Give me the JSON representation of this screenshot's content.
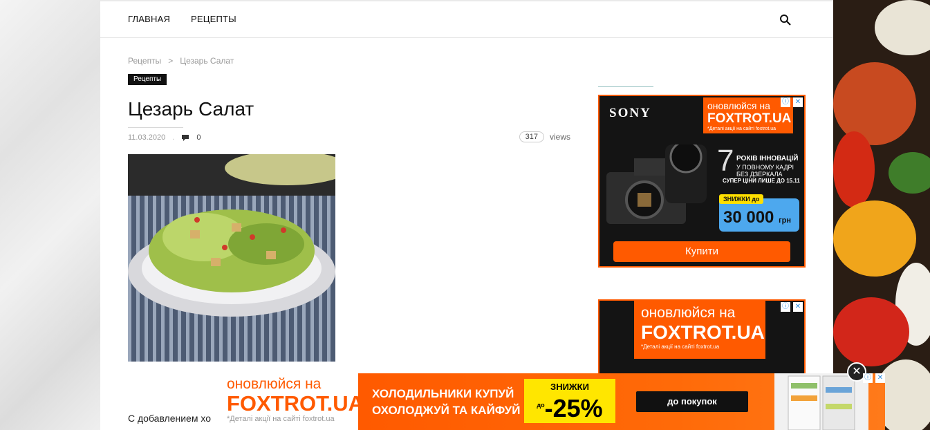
{
  "nav": {
    "home": "ГЛАВНАЯ",
    "recipes": "РЕЦЕПТЫ"
  },
  "breadcrumb": {
    "root": "Рецепты",
    "sep": ">",
    "current": "Цезарь Салат"
  },
  "category_badge": "Рецепты",
  "article": {
    "title": "Цезарь Салат",
    "date": "11.03.2020",
    "comments": "0",
    "views_count": "317",
    "views_label": "views",
    "body_start": "С добавлением хо"
  },
  "ad1": {
    "brand": "SONY",
    "ft_line1": "оновлюйся на",
    "ft_line2": "FOXTROT.UA",
    "ft_line3": "*Деталі акції на сайті foxtrot.ua",
    "seven": "7",
    "years1": "РОКІВ ІННОВАЦІЙ",
    "years2": "У ПОВНОМУ КАДРІ",
    "years3": "БЕЗ ДЗЕРКАЛА",
    "super_price": "СУПЕР ЦІНИ ЛИШЕ ДО 15.11",
    "discount_label": "ЗНИЖКИ до",
    "discount_value": "30 000",
    "discount_unit": "грн",
    "buy": "Купити"
  },
  "ad2": {
    "ft_line1": "оновлюйся на",
    "ft_line2": "FOXTROT.UA",
    "ft_line3": "*Деталі акції на сайті foxtrot.ua"
  },
  "banner": {
    "ft_line1": "оновлюйся на",
    "ft_line2": "FOXTROT.UA",
    "ft_line3": "*Деталі акції на сайті foxtrot.ua",
    "msg1": "ХОЛОДИЛЬНИКИ КУПУЙ",
    "msg2": "ОХОЛОДЖУЙ ТА КАЙФУЙ",
    "promo_label": "ЗНИЖКИ",
    "promo_prefix": "до",
    "promo_value": "-25%",
    "cta": "до покупок"
  },
  "ad_icons": {
    "info": "ⓘ",
    "close": "✕"
  },
  "colors": {
    "accent": "#ff5a00",
    "promo_yellow": "#ffe600",
    "discount_blue": "#4da8ee"
  }
}
